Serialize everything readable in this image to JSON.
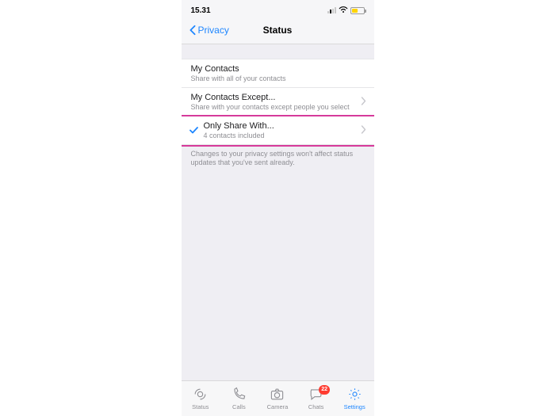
{
  "status": {
    "time": "15.31"
  },
  "nav": {
    "back": "Privacy",
    "title": "Status"
  },
  "options": {
    "my_contacts": {
      "title": "My Contacts",
      "sub": "Share with all of your contacts"
    },
    "except": {
      "title": "My Contacts Except...",
      "sub": "Share with your contacts except people you select"
    },
    "only": {
      "title": "Only Share With...",
      "sub": "4 contacts included"
    }
  },
  "note": "Changes to your privacy settings won't affect status updates that you've sent already.",
  "tabs": {
    "status": "Status",
    "calls": "Calls",
    "camera": "Camera",
    "chats": "Chats",
    "settings": "Settings",
    "chats_badge": "22"
  }
}
